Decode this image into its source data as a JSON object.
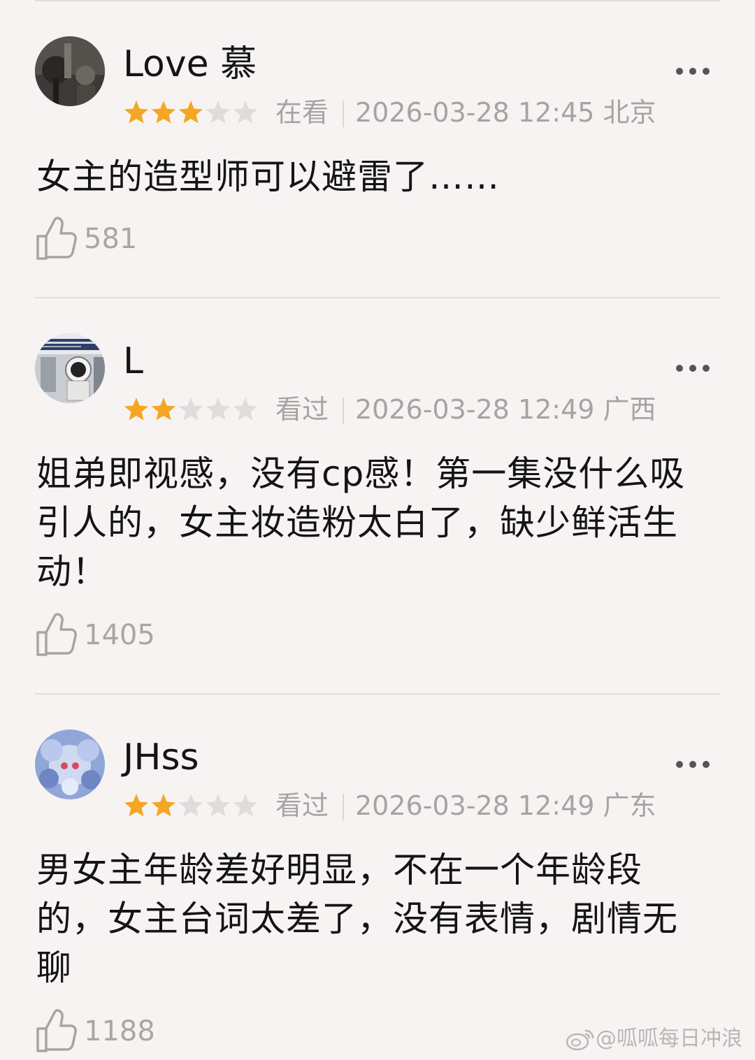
{
  "reviews": [
    {
      "username": "Love 慕",
      "rating": 3,
      "max_rating": 5,
      "status": "在看",
      "datetime": "2026-03-28 12:45 北京",
      "content": "女主的造型师可以避雷了……",
      "likes": "581"
    },
    {
      "username": "L",
      "rating": 2,
      "max_rating": 5,
      "status": "看过",
      "datetime": "2026-03-28 12:49 广西",
      "content": "姐弟即视感，没有cp感！第一集没什么吸引人的，女主妆造粉太白了，缺少鲜活生动！",
      "likes": "1405"
    },
    {
      "username": "JHss",
      "rating": 2,
      "max_rating": 5,
      "status": "看过",
      "datetime": "2026-03-28 12:49 广东",
      "content": "男女主年龄差好明显，不在一个年龄段的，女主台词太差了，没有表情，剧情无聊",
      "likes": "1188"
    }
  ],
  "colors": {
    "star_filled": "#f5a623",
    "star_empty": "#e0dcdc",
    "background": "#f7f3f3"
  },
  "icons": {
    "more": "more-dots-icon",
    "like": "thumbs-up-icon",
    "watermark": "weibo-logo-icon"
  },
  "watermark": {
    "text": "@呱呱每日冲浪"
  }
}
